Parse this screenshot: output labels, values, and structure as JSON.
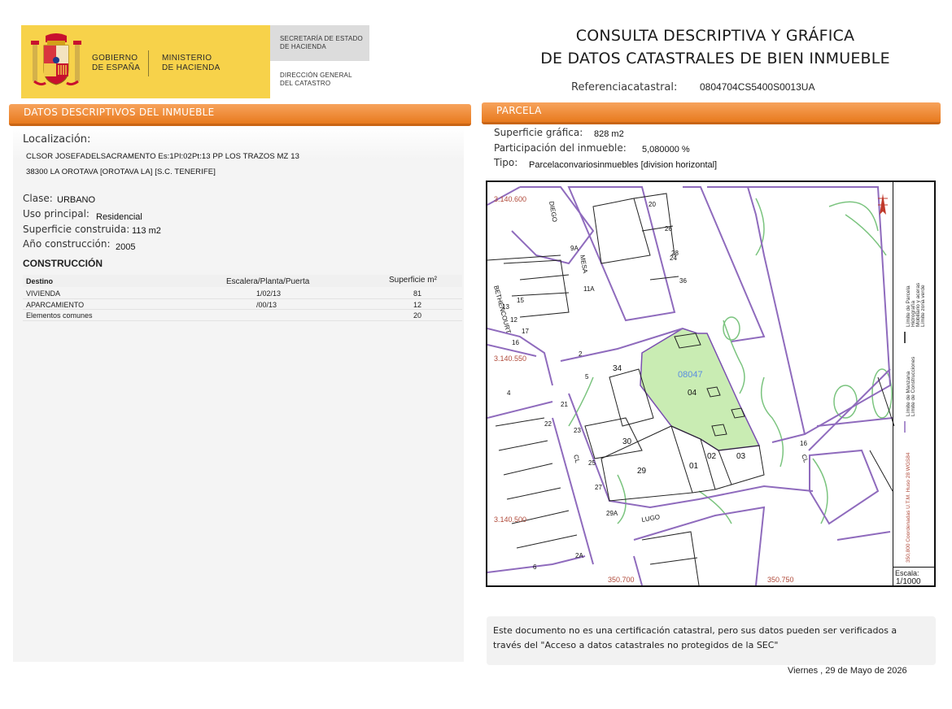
{
  "header": {
    "logo_gov_line1": "GOBIERNO",
    "logo_gov_line2": "DE ESPAÑA",
    "logo_min_line1": "MINISTERIO",
    "logo_min_line2": "DE HACIENDA",
    "secretaria_line1": "SECRETARÍA DE ESTADO",
    "secretaria_line2": "DE HACIENDA",
    "direccion_line1": "DIRECCIÓN GENERAL",
    "direccion_line2": "DEL CATASTRO",
    "title_line1": "CONSULTA DESCRIPTIVA Y GRÁFICA",
    "title_line2": "DE DATOS CATASTRALES DE BIEN INMUEBLE",
    "ref_label": "Referenciacatastral:",
    "ref_value": "0804704CS5400S0013UA"
  },
  "left": {
    "section_title": "DATOS DESCRIPTIVOS DEL INMUEBLE",
    "localizacion_label": "Localización:",
    "address_line1": "CLSOR JOSEFADELSACRAMENTO Es:1Pl:02Pt:13 PP LOS TRAZOS MZ 13",
    "address_line2": "38300 LA OROTAVA [OROTAVA LA] [S.C. TENERIFE]",
    "clase_label": "Clase:",
    "clase_value": "URBANO",
    "uso_label": "Uso principal:",
    "uso_value": "Residencial",
    "superficie_label": "Superficie construida:",
    "superficie_value": "113 m2",
    "anio_label": "Año construcción:",
    "anio_value": "2005",
    "construccion_title": "CONSTRUCCIÓN",
    "table": {
      "headers": [
        "Destino",
        "Escalera/Planta/Puerta",
        "Superficie m²"
      ],
      "rows": [
        [
          "VIVIENDA",
          "1/02/13",
          "81"
        ],
        [
          "APARCAMIENTO",
          "/00/13",
          "12"
        ],
        [
          "Elementos comunes",
          "",
          "20"
        ]
      ]
    }
  },
  "right": {
    "section_title": "PARCELA",
    "sup_grafica_label": "Superficie gráfica:",
    "sup_grafica_value": "828 m2",
    "participacion_label": "Participación del inmueble:",
    "participacion_value": "5,080000 %",
    "tipo_label": "Tipo:",
    "tipo_value": "Parcelaconvariosinmuebles [division horizontal]"
  },
  "map": {
    "coord_y_top": "3.140.600",
    "coord_y_mid": "3.140.550",
    "coord_y_bottom": "3.140.500",
    "coord_x_left": "350.700",
    "coord_x_right": "350.750",
    "parcel_code": "08047",
    "parcel_num": "04",
    "street_labels": [
      "DIEGO",
      "MESA",
      "BETHENCOURT",
      "LUGO",
      "CL",
      "CL"
    ],
    "block_numbers": [
      "30",
      "29",
      "01",
      "02",
      "03",
      "34",
      "2",
      "5",
      "4",
      "21",
      "22",
      "23",
      "25",
      "27",
      "29A",
      "2A",
      "13",
      "12",
      "17",
      "16",
      "36",
      "28",
      "26",
      "24",
      "20",
      "9A",
      "11A",
      "15",
      "6",
      "16"
    ],
    "legend_1": "Límite de Manzana",
    "legend_2": "Límite de Parcela",
    "legend_3": "Límite de Construcciones",
    "legend_4": "Mobiliario y aceras",
    "legend_5": "Límite zona verde",
    "legend_6": "Hidrografía",
    "coord_note": "350,800 Coordenadas U.T.M. Huso 28 WGS84",
    "scale_label": "Escala:",
    "scale_value": "1/1000"
  },
  "footer": {
    "note_line1": "Este documento no es una certificación catastral, pero sus datos pueden ser verificados a",
    "note_line2": "través del \"Acceso a datos catastrales no protegidos de la SEC\"",
    "date": "Viernes , 29 de Mayo de 2026"
  }
}
